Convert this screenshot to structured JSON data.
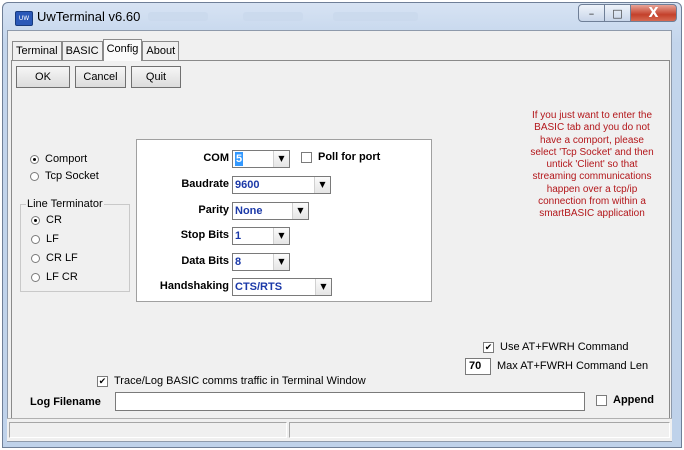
{
  "window": {
    "title": "UwTerminal v6.60",
    "app_icon_text": "UW",
    "minimize_glyph": "–",
    "maximize_glyph": "□",
    "close_glyph": "X"
  },
  "tabs": [
    {
      "label": "Terminal",
      "active": false
    },
    {
      "label": "BASIC",
      "active": false
    },
    {
      "label": "Config",
      "active": true
    },
    {
      "label": "About",
      "active": false
    }
  ],
  "toolbar": {
    "ok_label": "OK",
    "cancel_label": "Cancel",
    "quit_label": "Quit"
  },
  "connection": {
    "options": [
      {
        "label": "Comport",
        "selected": true
      },
      {
        "label": "Tcp Socket",
        "selected": false
      }
    ]
  },
  "line_terminator": {
    "legend": "Line Terminator",
    "options": [
      {
        "label": "CR",
        "selected": true
      },
      {
        "label": "LF",
        "selected": false
      },
      {
        "label": "CR LF",
        "selected": false
      },
      {
        "label": "LF CR",
        "selected": false
      }
    ]
  },
  "port_settings": {
    "com_label": "COM",
    "com_value": "5",
    "poll_label": "Poll for port",
    "poll_checked": false,
    "baudrate_label": "Baudrate",
    "baudrate_value": "9600",
    "parity_label": "Parity",
    "parity_value": "None",
    "stopbits_label": "Stop Bits",
    "stopbits_value": "1",
    "databits_label": "Data Bits",
    "databits_value": "8",
    "handshaking_label": "Handshaking",
    "handshaking_value": "CTS/RTS"
  },
  "note": {
    "text": "If you just want to enter the BASIC tab and you do not have a comport, please select  'Tcp Socket' and then untick 'Client' so that streaming communications happen over a tcp/ip connection from within a smartBASIC application",
    "color": "#b3171b"
  },
  "fwrh": {
    "use_label": "Use AT+FWRH Command",
    "use_checked": true,
    "max_value": "70",
    "max_label": "Max AT+FWRH Command Len"
  },
  "trace": {
    "label": "Trace/Log BASIC comms traffic in Terminal Window",
    "checked": true
  },
  "log": {
    "filename_label": "Log Filename",
    "filename_value": "",
    "append_label": "Append",
    "append_checked": false
  },
  "icons": {
    "dropdown_arrow": "▼",
    "check_mark": "✔"
  }
}
